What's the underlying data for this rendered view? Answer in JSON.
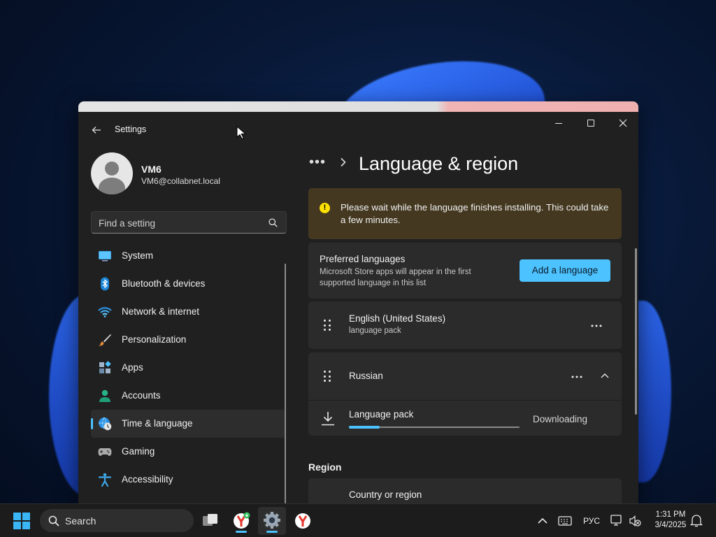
{
  "window": {
    "app_title": "Settings",
    "back_icon": "back-arrow-icon"
  },
  "profile": {
    "name": "VM6",
    "email": "VM6@collabnet.local"
  },
  "search": {
    "placeholder": "Find a setting"
  },
  "sidebar": {
    "items": [
      {
        "label": "System",
        "icon": "system-icon"
      },
      {
        "label": "Bluetooth & devices",
        "icon": "bluetooth-icon"
      },
      {
        "label": "Network & internet",
        "icon": "wifi-icon"
      },
      {
        "label": "Personalization",
        "icon": "brush-icon"
      },
      {
        "label": "Apps",
        "icon": "apps-icon"
      },
      {
        "label": "Accounts",
        "icon": "person-icon"
      },
      {
        "label": "Time & language",
        "icon": "globe-clock-icon",
        "active": true
      },
      {
        "label": "Gaming",
        "icon": "gamepad-icon"
      },
      {
        "label": "Accessibility",
        "icon": "accessibility-icon"
      }
    ]
  },
  "main": {
    "breadcrumb_more": "•••",
    "page_title": "Language & region",
    "notice": "Please wait while the language finishes installing. This could take a few minutes.",
    "preferred": {
      "title": "Preferred languages",
      "subtitle": "Microsoft Store apps will appear in the first supported language in this list",
      "add_button": "Add a language"
    },
    "languages": [
      {
        "name": "English (United States)",
        "sub": "language pack"
      },
      {
        "name": "Russian"
      }
    ],
    "download": {
      "label": "Language pack",
      "status": "Downloading",
      "progress": 0.18
    },
    "region": {
      "heading": "Region",
      "country_label": "Country or region"
    }
  },
  "taskbar": {
    "search_label": "Search",
    "language_indicator": "РУС",
    "time": "1:31 PM",
    "date": "3/4/2025"
  },
  "colors": {
    "accent": "#4cc2ff",
    "notice_bg": "#443820",
    "window_bg": "#202020",
    "card_bg": "#2b2b2b"
  }
}
